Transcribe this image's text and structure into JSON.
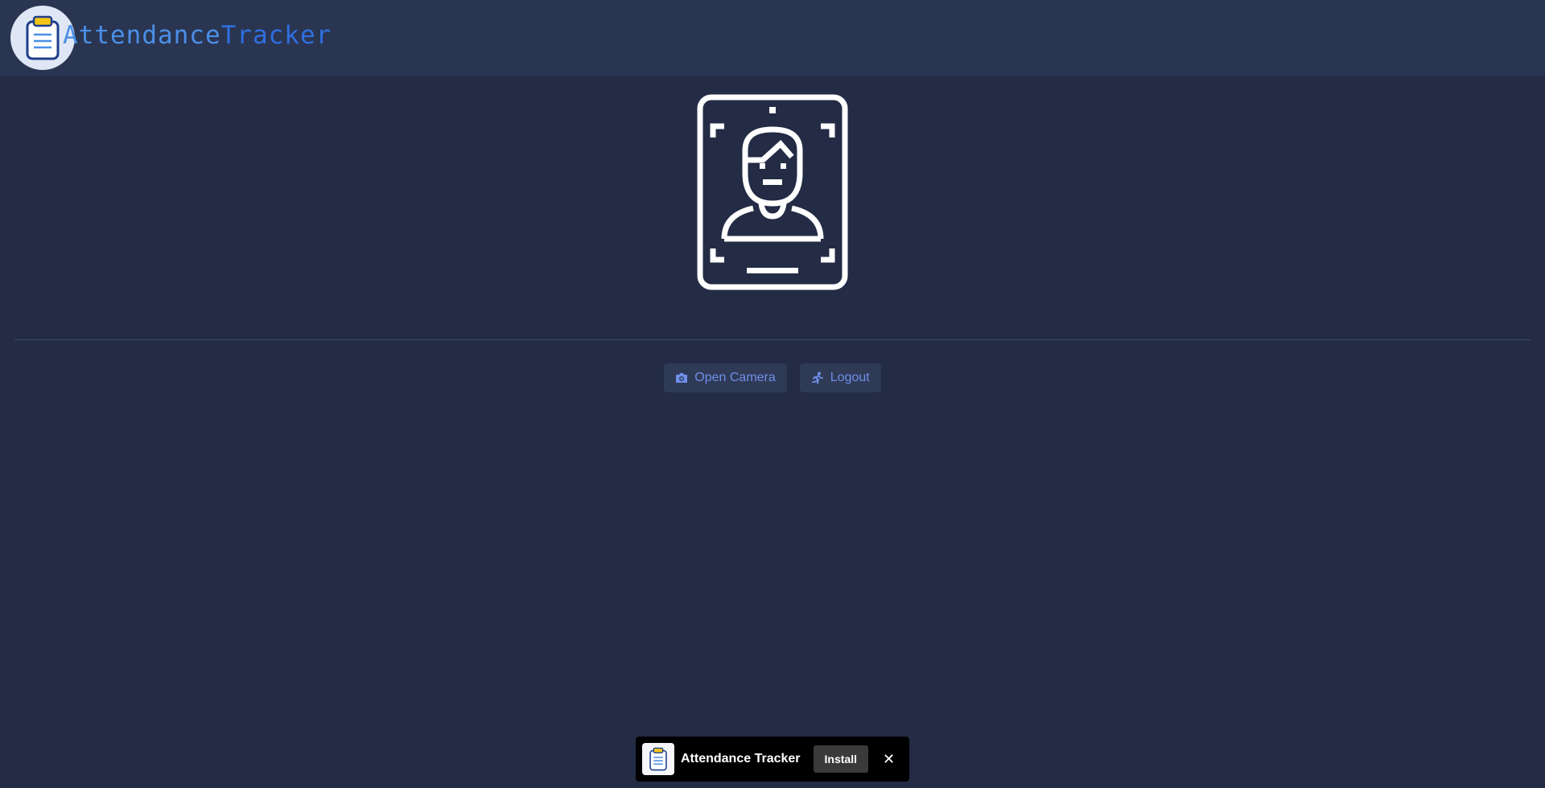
{
  "header": {
    "brand_part1": "Attendance",
    "brand_part2": "Tracker",
    "logo_icon": "clipboard-icon"
  },
  "hero": {
    "icon": "face-id-phone-icon"
  },
  "actions": {
    "open_camera": {
      "label": "Open Camera",
      "icon": "camera-icon"
    },
    "logout": {
      "label": "Logout",
      "icon": "running-person-icon"
    }
  },
  "install_banner": {
    "title": "Attendance Tracker",
    "install_label": "Install",
    "close_label": "✕",
    "icon": "clipboard-icon"
  },
  "colors": {
    "background": "#232b45",
    "header": "#2a3551",
    "accent": "#6f8fe8",
    "brand_blue": "#2f6fe0"
  }
}
